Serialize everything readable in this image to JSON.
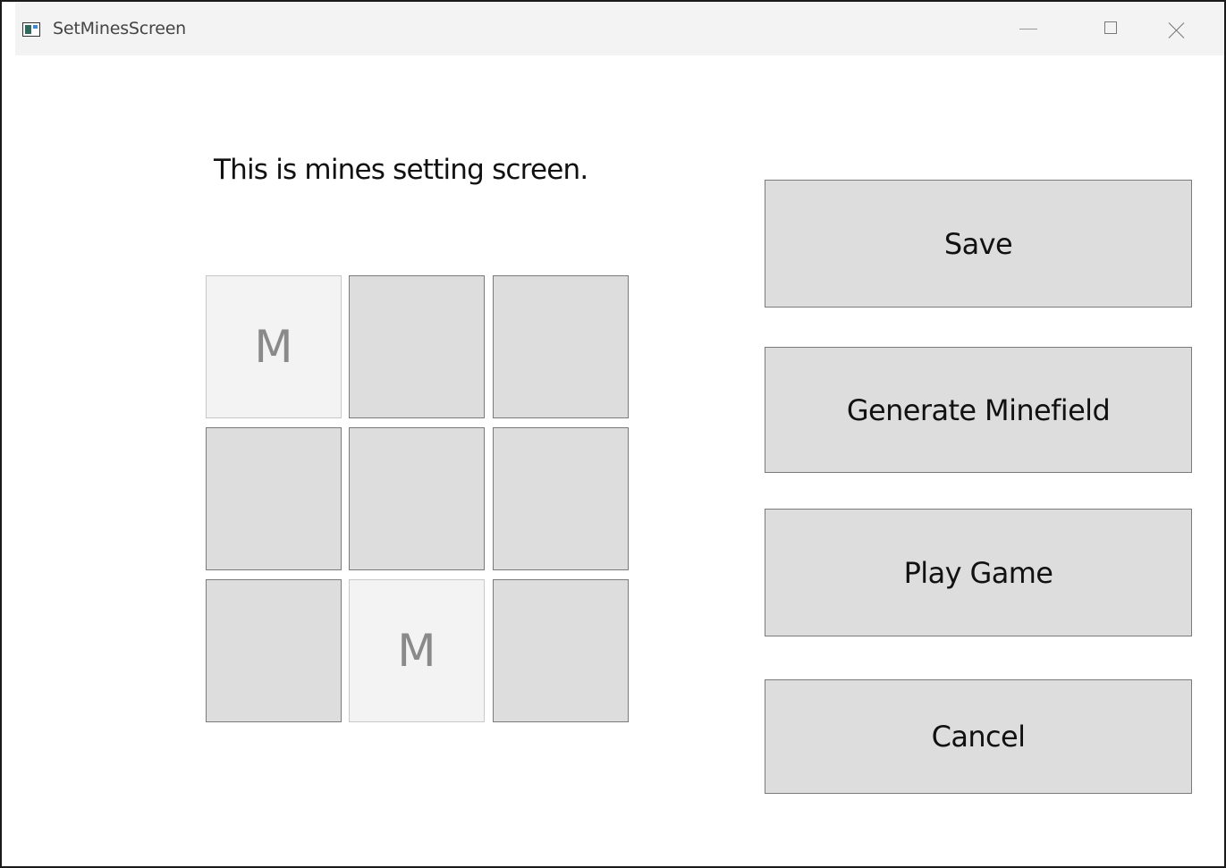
{
  "window": {
    "title": "SetMinesScreen",
    "icon": "app-window-icon",
    "controls": {
      "minimize": "minimize-icon",
      "maximize": "maximize-icon",
      "close": "close-icon"
    }
  },
  "main": {
    "heading": "This is mines setting screen.",
    "grid": {
      "rows": 3,
      "cols": 3,
      "cells": [
        [
          "M",
          "",
          ""
        ],
        [
          "",
          "",
          ""
        ],
        [
          "",
          "M",
          ""
        ]
      ]
    },
    "buttons": {
      "save": "Save",
      "generate": "Generate Minefield",
      "play": "Play Game",
      "cancel": "Cancel"
    }
  },
  "colors": {
    "cell_default": "#dddddd",
    "cell_mine": "#f3f3f3",
    "mine_text": "#8a8a8a",
    "button_bg": "#dddddd",
    "titlebar_bg": "#f3f3f3"
  }
}
